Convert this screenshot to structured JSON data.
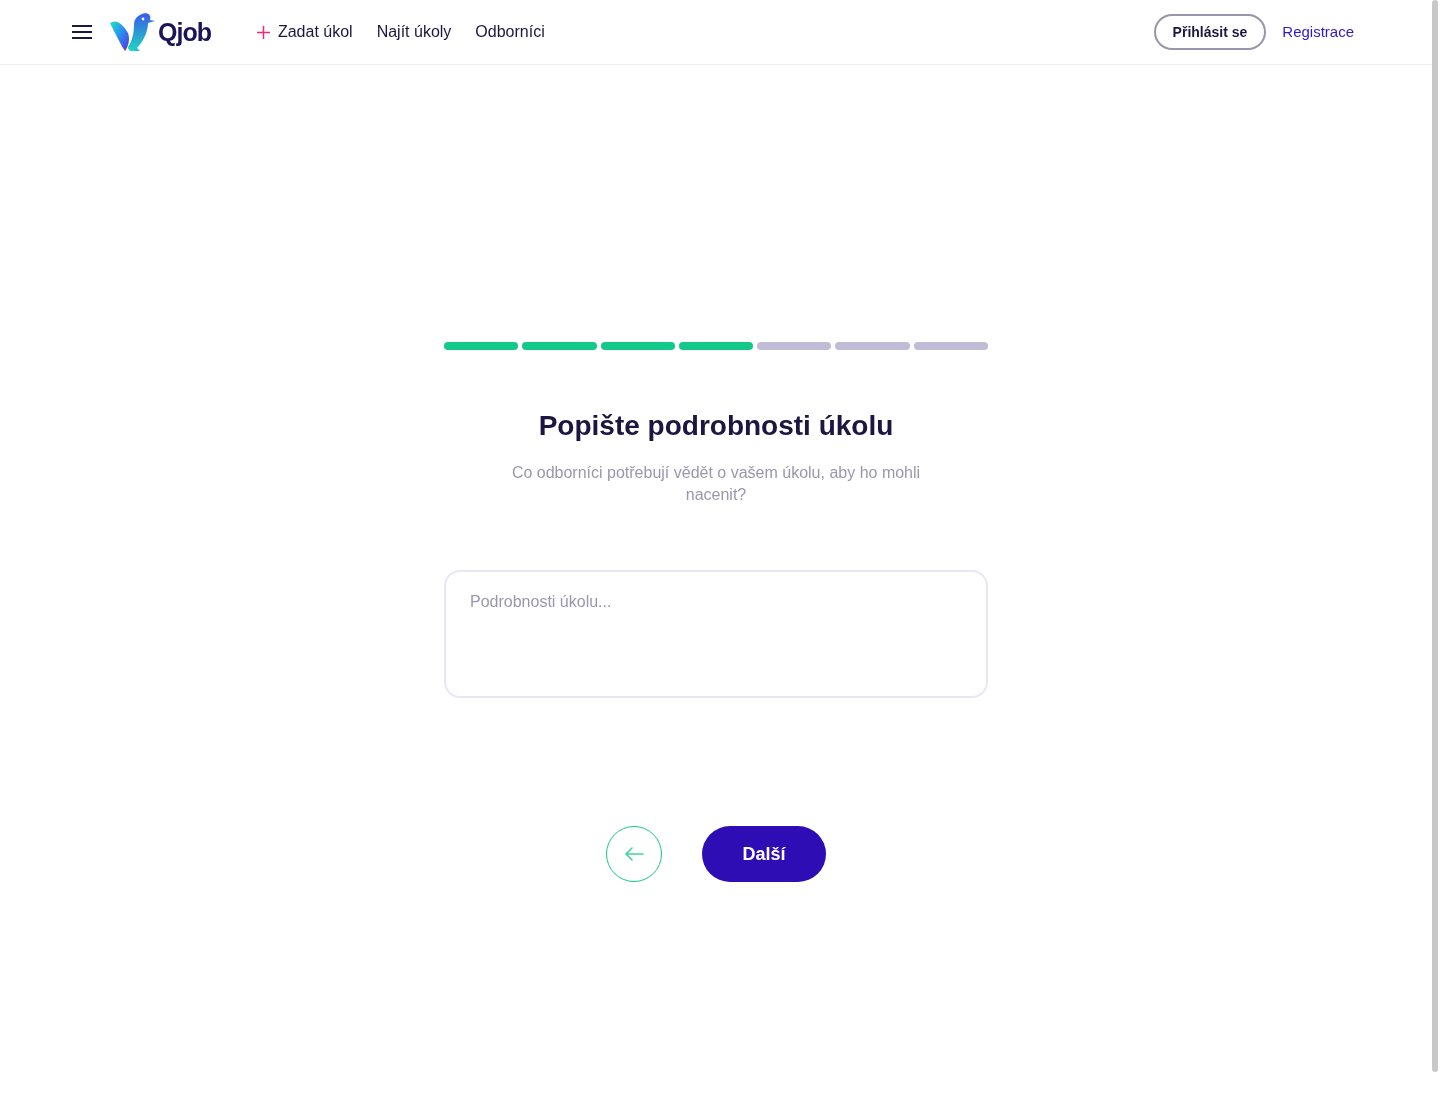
{
  "header": {
    "brand": "Qjob",
    "nav": [
      {
        "kind": "add",
        "label": "Zadat úkol"
      },
      {
        "kind": "link",
        "label": "Najít úkoly"
      },
      {
        "kind": "link",
        "label": "Odborníci"
      }
    ],
    "login": "Přihlásit se",
    "register": "Registrace"
  },
  "progress": {
    "steps": [
      {
        "done": true
      },
      {
        "done": true
      },
      {
        "done": true
      },
      {
        "done": true
      },
      {
        "done": false
      },
      {
        "done": false
      },
      {
        "done": false
      }
    ]
  },
  "title": "Popište podrobnosti úkolu",
  "subtitle": "Co odborníci potřebují vědět o vašem úkolu, aby ho mohli nacenit?",
  "details": {
    "placeholder": "Podrobnosti úkolu..."
  },
  "actions": {
    "next": "Další"
  }
}
